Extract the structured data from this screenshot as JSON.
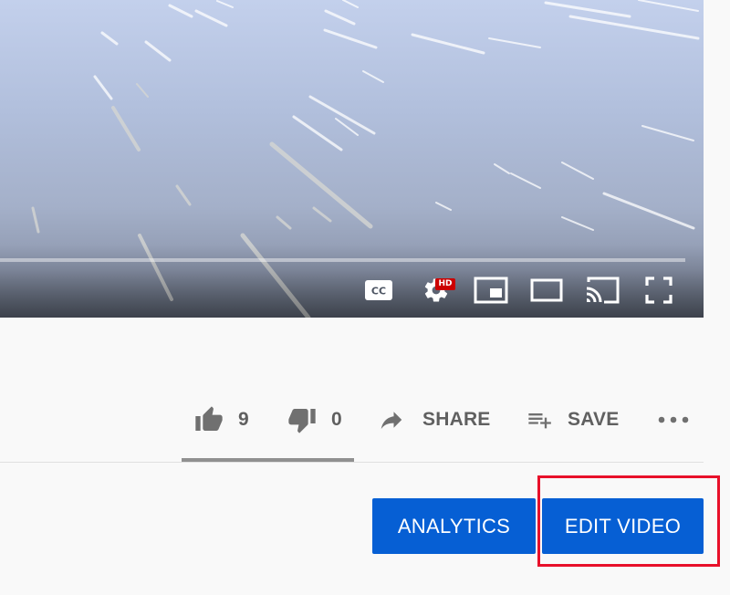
{
  "player": {
    "controls": {
      "captions_icon": "cc-icon",
      "captions_label": "CC",
      "settings_icon": "gear-icon",
      "quality_badge": "HD",
      "miniplayer_icon": "miniplayer-icon",
      "theater_icon": "theater-mode-icon",
      "cast_icon": "cast-icon",
      "fullscreen_icon": "fullscreen-icon"
    }
  },
  "actions": {
    "like": {
      "icon": "thumbs-up-icon",
      "count": "9"
    },
    "dislike": {
      "icon": "thumbs-down-icon",
      "count": "0"
    },
    "share": {
      "icon": "share-arrow-icon",
      "label": "SHARE"
    },
    "save": {
      "icon": "playlist-add-icon",
      "label": "SAVE"
    },
    "more": {
      "icon": "more-horizontal-icon"
    }
  },
  "owner": {
    "analytics_label": "ANALYTICS",
    "edit_label": "EDIT VIDEO"
  },
  "colors": {
    "accent_blue": "#065fd4",
    "highlight_red": "#e8102a",
    "hd_red": "#cc0000",
    "action_gray": "#606060"
  }
}
